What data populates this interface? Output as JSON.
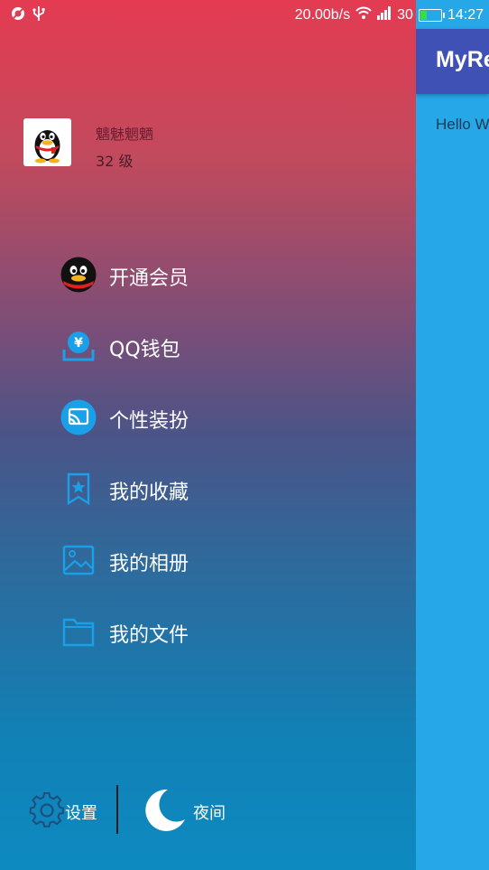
{
  "statusbar": {
    "speed": "20.00b/s",
    "battery": "30",
    "battery_level": 0.3,
    "time": "14:27"
  },
  "profile": {
    "name": "魑魅魍魉",
    "level": "32 级"
  },
  "menu": [
    {
      "label": "开通会员",
      "icon": "qq-penguin-icon"
    },
    {
      "label": "QQ钱包",
      "icon": "wallet-icon"
    },
    {
      "label": "个性装扮",
      "icon": "theme-icon"
    },
    {
      "label": "我的收藏",
      "icon": "bookmark-icon"
    },
    {
      "label": "我的相册",
      "icon": "album-icon"
    },
    {
      "label": "我的文件",
      "icon": "folder-icon"
    }
  ],
  "bottom": {
    "settings_label": "设置",
    "night_label": "夜间"
  },
  "main": {
    "toolbar_title": "MyRe",
    "content": "Hello W"
  },
  "colors": {
    "toolbar": "#3f51b5",
    "content_bg": "#26a7e8",
    "icon_blue": "#1aa0e8"
  }
}
